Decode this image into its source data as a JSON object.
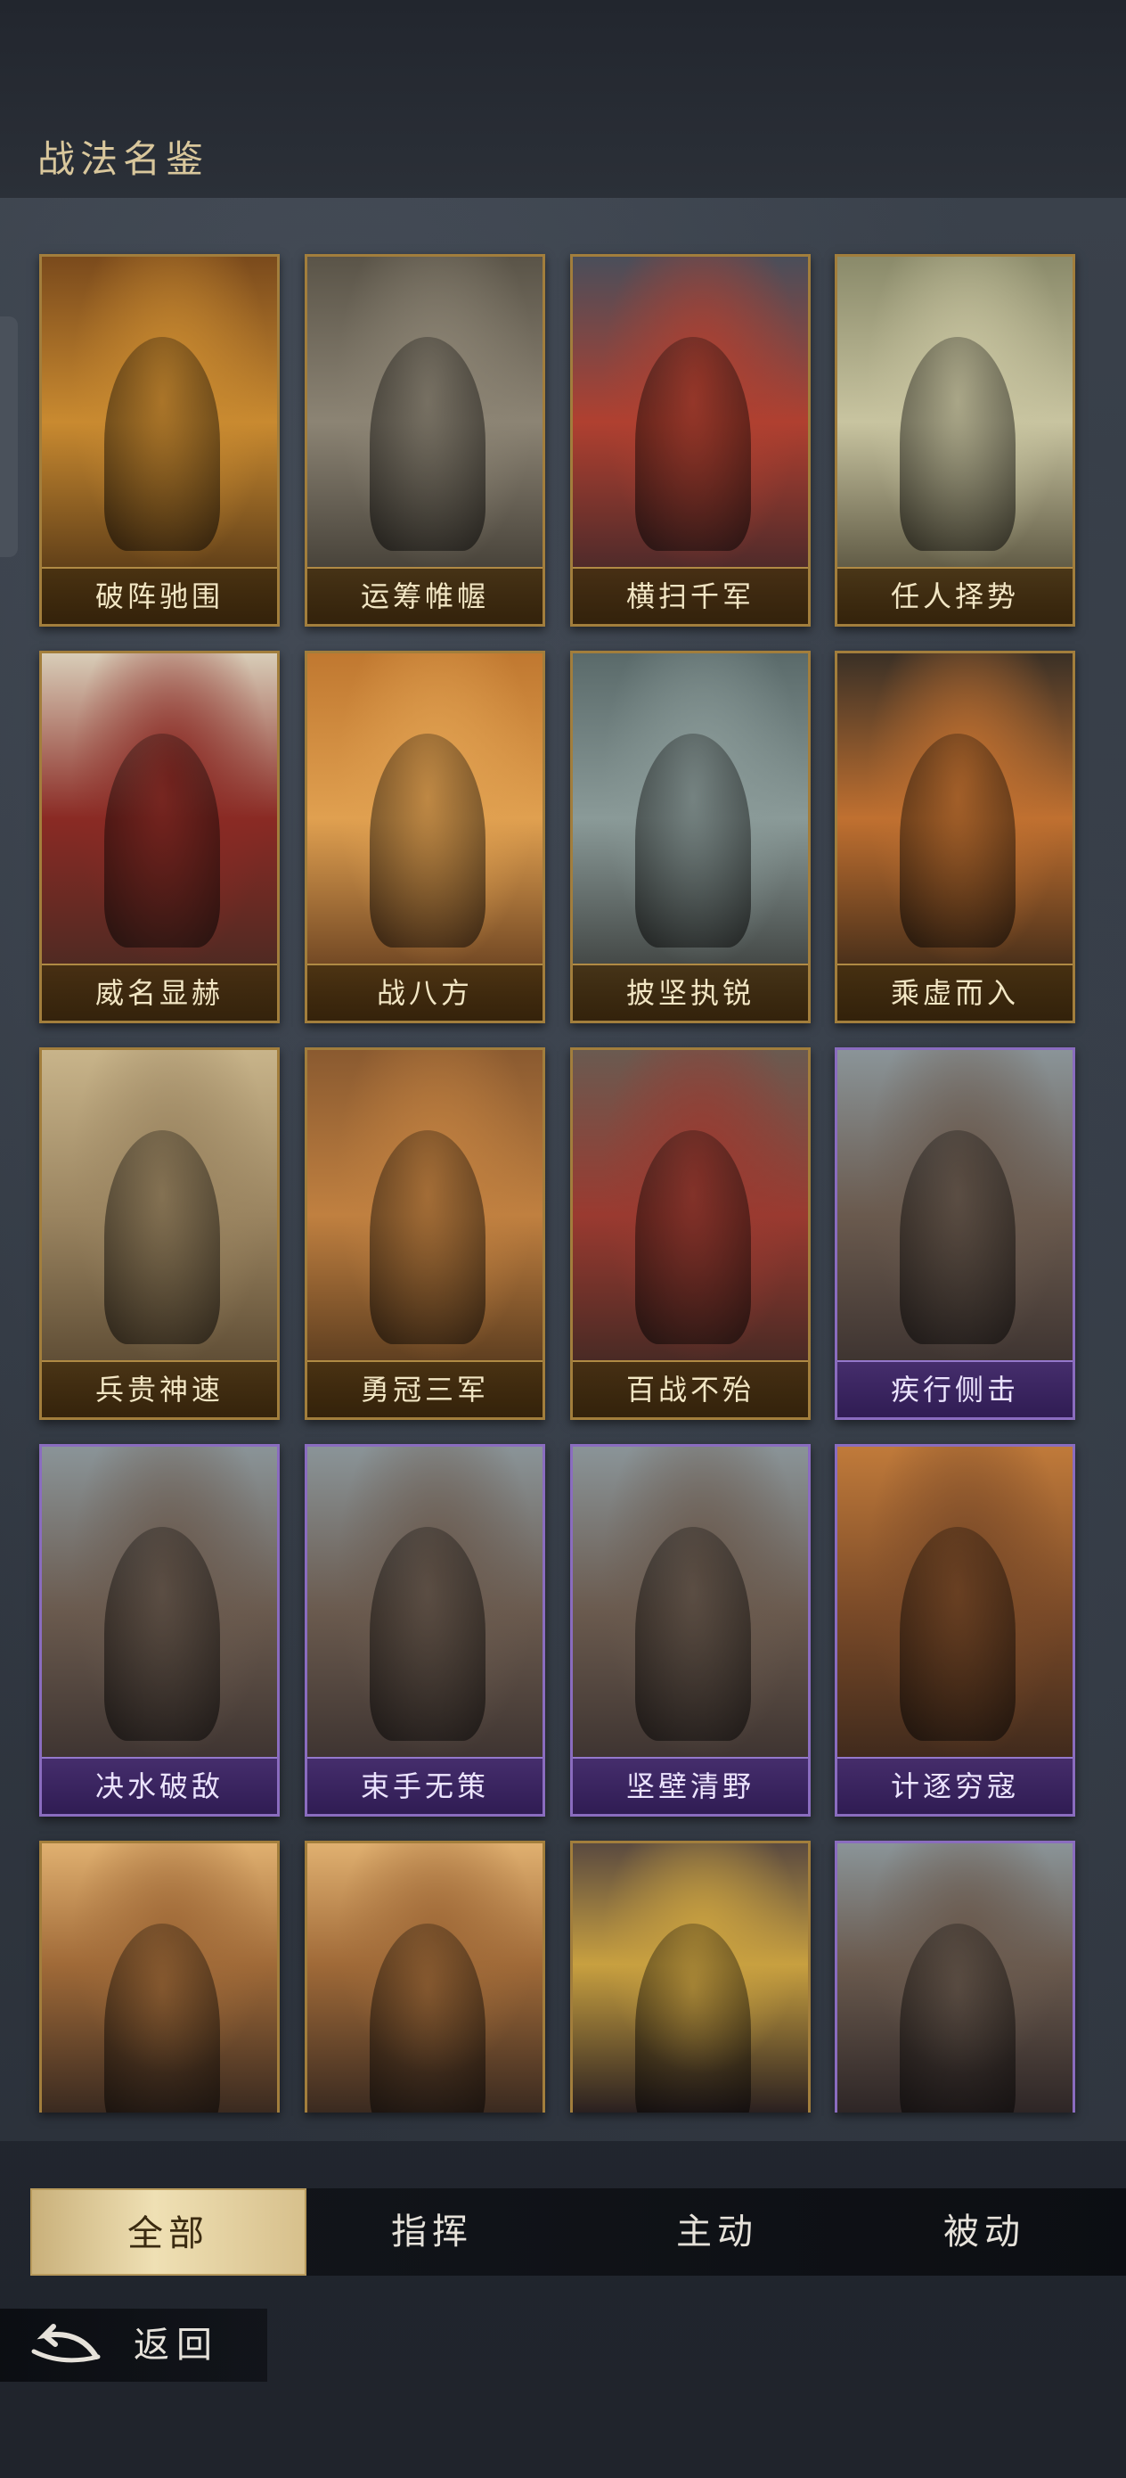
{
  "header": {
    "title": "战法名鉴"
  },
  "cards": [
    {
      "label": "破阵驰围",
      "rarity": "gold",
      "art": "warrior-golden-blade",
      "bg": [
        "#7a4a1c",
        "#c98a30",
        "#3a2410"
      ]
    },
    {
      "label": "运筹帷幄",
      "rarity": "gold",
      "art": "palace-hall",
      "bg": [
        "#5a5448",
        "#8c8474",
        "#2e2a24"
      ]
    },
    {
      "label": "横扫千军",
      "rarity": "gold",
      "art": "cavalry-charge",
      "bg": [
        "#4a4e5a",
        "#b04030",
        "#2a2228"
      ]
    },
    {
      "label": "任人择势",
      "rarity": "gold",
      "art": "hands-sword",
      "bg": [
        "#8a8a6a",
        "#c8c4a0",
        "#3a3424"
      ]
    },
    {
      "label": "威名显赫",
      "rarity": "gold",
      "art": "general-on-horse",
      "bg": [
        "#d8cdb8",
        "#8a2a24",
        "#3a2a22"
      ]
    },
    {
      "label": "战八方",
      "rarity": "gold",
      "art": "war-drum",
      "bg": [
        "#c07830",
        "#e0a050",
        "#4a2814"
      ]
    },
    {
      "label": "披坚执锐",
      "rarity": "gold",
      "art": "armored-general",
      "bg": [
        "#5a6a6a",
        "#8a9a98",
        "#2a2a28"
      ]
    },
    {
      "label": "乘虚而入",
      "rarity": "gold",
      "art": "night-raid-gate",
      "bg": [
        "#3a3026",
        "#c07030",
        "#1e1812"
      ]
    },
    {
      "label": "兵贵神速",
      "rarity": "gold",
      "art": "riders-dust",
      "bg": [
        "#c8b48a",
        "#9a8460",
        "#4a3a26"
      ]
    },
    {
      "label": "勇冠三军",
      "rarity": "gold",
      "art": "battle-fire",
      "bg": [
        "#8a5a30",
        "#c08040",
        "#3a2614"
      ]
    },
    {
      "label": "百战不殆",
      "rarity": "gold",
      "art": "army-red-banner",
      "bg": [
        "#6a5a50",
        "#9a3a30",
        "#2a2420"
      ]
    },
    {
      "label": "疾行侧击",
      "rarity": "purple",
      "art": "cavalry-general",
      "bg": [
        "#8a9498",
        "#6a5a4e",
        "#2e2626"
      ]
    },
    {
      "label": "决水破敌",
      "rarity": "purple",
      "art": "cavalry-general",
      "bg": [
        "#8a9498",
        "#6a5a4e",
        "#2e2626"
      ]
    },
    {
      "label": "束手无策",
      "rarity": "purple",
      "art": "cavalry-general",
      "bg": [
        "#8a9498",
        "#6a5a4e",
        "#2e2626"
      ]
    },
    {
      "label": "坚壁清野",
      "rarity": "purple",
      "art": "cavalry-general",
      "bg": [
        "#8a9498",
        "#6a5a4e",
        "#2e2626"
      ]
    },
    {
      "label": "计逐穷寇",
      "rarity": "purple",
      "art": "standing-general",
      "bg": [
        "#c07a3a",
        "#7a4a28",
        "#2a1e18"
      ]
    },
    {
      "label": "",
      "rarity": "gold",
      "art": "spear-general",
      "bg": [
        "#e0b070",
        "#a06a38",
        "#3a2a20"
      ]
    },
    {
      "label": "",
      "rarity": "gold",
      "art": "spear-general",
      "bg": [
        "#e0b070",
        "#a06a38",
        "#3a2a20"
      ]
    },
    {
      "label": "",
      "rarity": "gold",
      "art": "red-warrior-slash",
      "bg": [
        "#5a4a40",
        "#c8a040",
        "#2a2020"
      ]
    },
    {
      "label": "",
      "rarity": "purple",
      "art": "cavalry-general",
      "bg": [
        "#8a9498",
        "#6a5a4e",
        "#2e2626"
      ]
    }
  ],
  "tabs": [
    {
      "label": "全部",
      "active": true
    },
    {
      "label": "指挥",
      "active": false
    },
    {
      "label": "主动",
      "active": false
    },
    {
      "label": "被动",
      "active": false
    }
  ],
  "back": {
    "label": "返回",
    "icon": "back-arrow-icon"
  }
}
